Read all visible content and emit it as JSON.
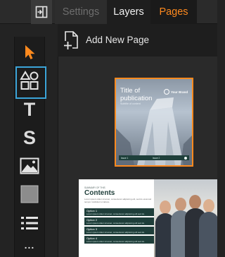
{
  "header": {
    "tabs": [
      {
        "label": "Settings",
        "state": "disabled"
      },
      {
        "label": "Layers",
        "state": "normal"
      },
      {
        "label": "Pages",
        "state": "active"
      }
    ],
    "collapse_icon": "panel-collapse-icon"
  },
  "toolbar": {
    "tools": [
      {
        "name": "select-tool",
        "icon": "cursor-arrow-icon",
        "selected": false
      },
      {
        "name": "shapes-tool",
        "icon": "shapes-icon",
        "selected": true
      },
      {
        "name": "text-tool",
        "glyph": "T",
        "icon": "text-icon",
        "selected": false
      },
      {
        "name": "styles-tool",
        "glyph": "S",
        "icon": "style-icon",
        "selected": false
      },
      {
        "name": "image-tool",
        "icon": "image-icon",
        "selected": false
      },
      {
        "name": "rectangle-tool",
        "icon": "square-icon",
        "selected": false
      },
      {
        "name": "list-tool",
        "icon": "list-icon",
        "selected": false
      },
      {
        "name": "more-tool",
        "glyph": "...",
        "icon": "more-icon",
        "selected": false
      }
    ]
  },
  "pages_panel": {
    "add_page_label": "Add New Page",
    "pages": [
      {
        "selected": true,
        "title": "Title of publication",
        "subtitle": "Subtitle of content",
        "brand": "Your Brand",
        "bar_left": "Issue 1",
        "bar_right": "Issue 2"
      },
      {
        "selected": false,
        "small_label": "SUMMARY OF THIS",
        "title": "Contents",
        "intro": "Lorem ipsum dolor sit amet, consectetur adipiscing elit, sed do eiusmod tempor incididunt ut labore.",
        "options": [
          {
            "title": "Option 1",
            "desc": "Lorem ipsum dolor sit amet, consectetur adipiscing elit sed do."
          },
          {
            "title": "Option 2",
            "desc": "Lorem ipsum dolor sit amet, consectetur adipiscing elit sed do."
          },
          {
            "title": "Option 3",
            "desc": "Lorem ipsum dolor sit amet, consectetur adipiscing elit sed do."
          },
          {
            "title": "Option 4",
            "desc": "Lorem ipsum dolor sit amet, consectetur adipiscing elit sed do."
          }
        ]
      }
    ]
  },
  "colors": {
    "accent_orange": "#ff8a1e",
    "selection_blue": "#3ba4d8",
    "panel_dark": "#232323",
    "teal": "#1f3e3a"
  }
}
